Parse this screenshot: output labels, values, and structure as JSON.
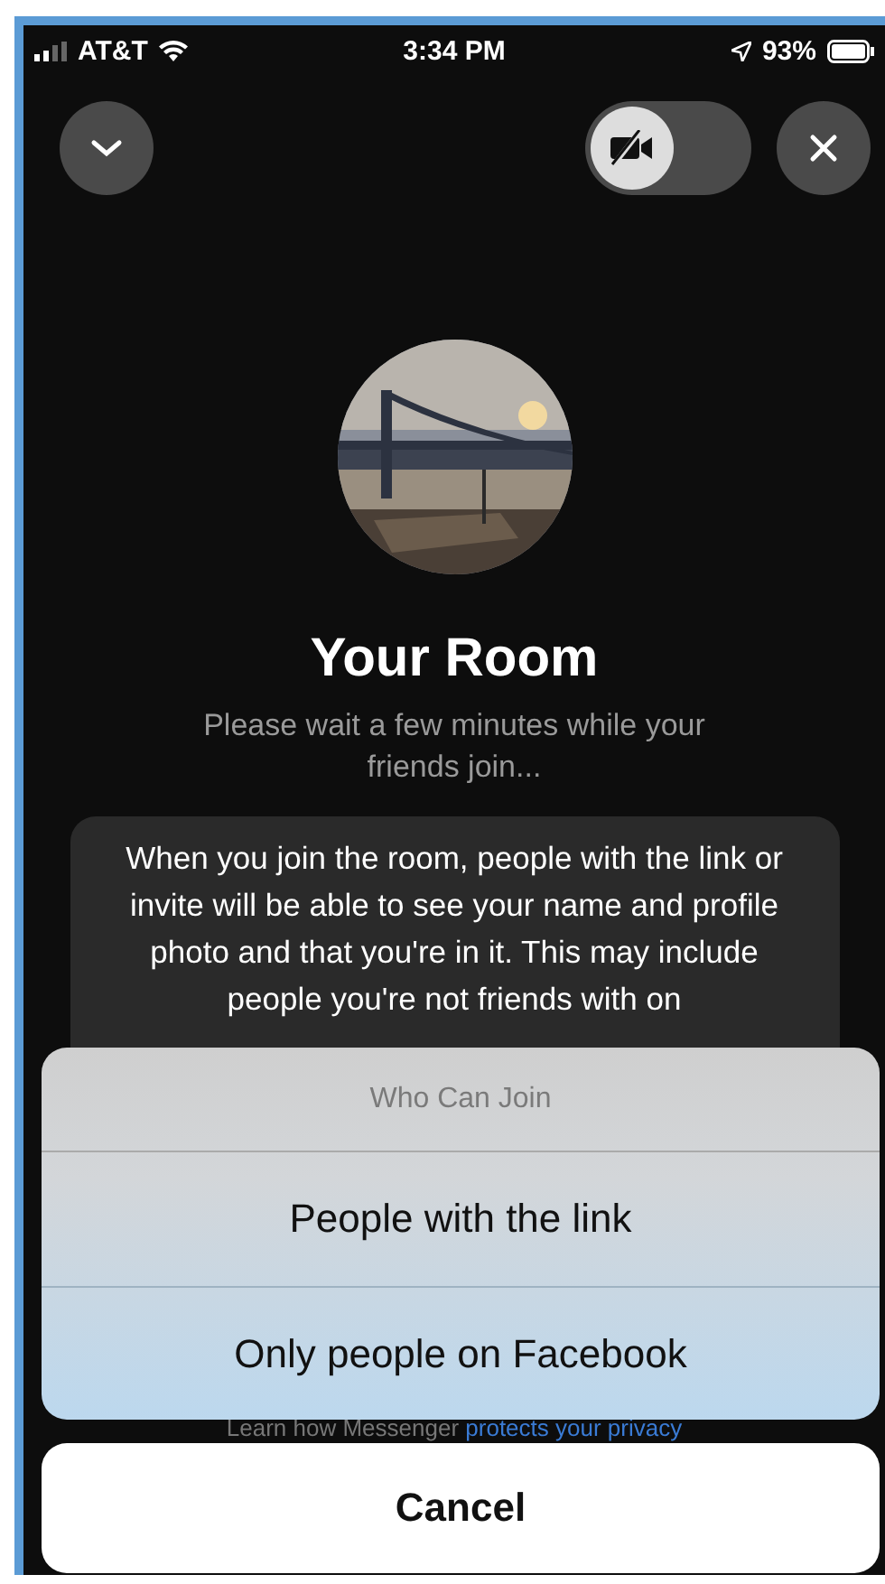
{
  "status_bar": {
    "carrier": "AT&T",
    "time": "3:34 PM",
    "battery": "93%"
  },
  "top_bar": {
    "video_enabled": false
  },
  "room": {
    "title": "Your Room",
    "subtitle": "Please wait a few minutes while your friends join...",
    "notice": "When you join the room, people with the link or invite will be able to see your name and profile photo and that you're in it. This may include people you're not friends with on"
  },
  "privacy_note": {
    "text": "Learn how Messenger",
    "link": "protects your privacy"
  },
  "sheet": {
    "title": "Who Can Join",
    "options": [
      {
        "label": "People with the link"
      },
      {
        "label": "Only people on Facebook"
      }
    ],
    "cancel": "Cancel"
  }
}
